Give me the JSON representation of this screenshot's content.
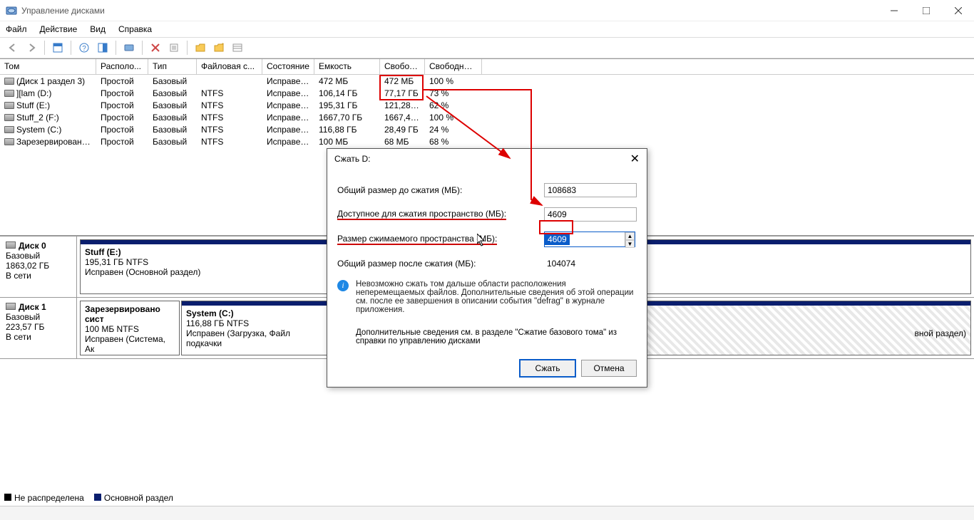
{
  "window": {
    "title": "Управление дисками"
  },
  "menu": {
    "file": "Файл",
    "action": "Действие",
    "view": "Вид",
    "help": "Справка"
  },
  "columns": {
    "tom": "Том",
    "raspol": "Располо...",
    "tip": "Тип",
    "fs": "Файловая с...",
    "sost": "Состояние",
    "emk": "Емкость",
    "svob": "Свобод...",
    "pct": "Свободно %"
  },
  "volumes": [
    {
      "name": "(Диск 1 раздел 3)",
      "layout": "Простой",
      "type": "Базовый",
      "fs": "",
      "status": "Исправен...",
      "cap": "472 МБ",
      "free": "472 МБ",
      "pct": "100 %"
    },
    {
      "name": "][lam (D:)",
      "layout": "Простой",
      "type": "Базовый",
      "fs": "NTFS",
      "status": "Исправен...",
      "cap": "106,14 ГБ",
      "free": "77,17 ГБ",
      "pct": "73 %"
    },
    {
      "name": "Stuff (E:)",
      "layout": "Простой",
      "type": "Базовый",
      "fs": "NTFS",
      "status": "Исправен...",
      "cap": "195,31 ГБ",
      "free": "121,28 ГБ",
      "pct": "62 %"
    },
    {
      "name": "Stuff_2 (F:)",
      "layout": "Простой",
      "type": "Базовый",
      "fs": "NTFS",
      "status": "Исправен...",
      "cap": "1667,70 ГБ",
      "free": "1667,47 ...",
      "pct": "100 %"
    },
    {
      "name": "System (C:)",
      "layout": "Простой",
      "type": "Базовый",
      "fs": "NTFS",
      "status": "Исправен...",
      "cap": "116,88 ГБ",
      "free": "28,49 ГБ",
      "pct": "24 %"
    },
    {
      "name": "Зарезервировано...",
      "layout": "Простой",
      "type": "Базовый",
      "fs": "NTFS",
      "status": "Исправен...",
      "cap": "100 МБ",
      "free": "68 МБ",
      "pct": "68 %"
    }
  ],
  "disk0": {
    "name": "Диск 0",
    "type": "Базовый",
    "size": "1863,02 ГБ",
    "status": "В сети",
    "part1_name": "Stuff  (E:)",
    "part1_size": "195,31 ГБ NTFS",
    "part1_status": "Исправен (Основной раздел)"
  },
  "disk1": {
    "name": "Диск 1",
    "type": "Базовый",
    "size": "223,57 ГБ",
    "status": "В сети",
    "p1_name": "Зарезервировано сист",
    "p1_size": "100 МБ NTFS",
    "p1_status": "Исправен (Система, Ак",
    "p2_name": "System  (C:)",
    "p2_size": "116,88 ГБ NTFS",
    "p2_status": "Исправен (Загрузка, Файл подкачки",
    "p3_status": "вной раздел)"
  },
  "legend": {
    "unalloc": "Не распределена",
    "primary": "Основной раздел"
  },
  "dialog": {
    "title": "Сжать D:",
    "lbl_total": "Общий размер до сжатия (МБ):",
    "val_total": "108683",
    "lbl_avail": "Доступное для сжатия пространство (МБ):",
    "val_avail": "4609",
    "lbl_shrink": "Размер сжимаемого пространства (МБ):",
    "val_shrink": "4609",
    "lbl_after": "Общий размер после сжатия (МБ):",
    "val_after": "104074",
    "info1": "Невозможно сжать том дальше области расположения неперемещаемых файлов. Дополнительные сведения об этой операции см. после ее завершения в описании события \"defrag\" в журнале приложения.",
    "info2": "Дополнительные сведения см. в разделе \"Сжатие базового тома\" из справки по управлению дисками",
    "btn_shrink": "Сжать",
    "btn_cancel": "Отмена"
  }
}
